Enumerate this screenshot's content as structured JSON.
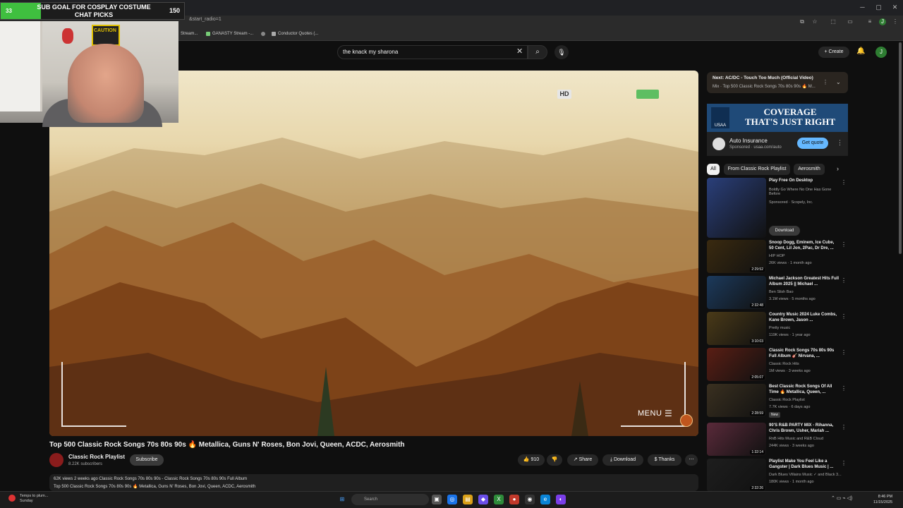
{
  "browser": {
    "url_fragment": "&start_radio=1",
    "bookmarks": [
      "Stream...",
      "GANASTY Stream -...",
      "Conductor Quotes (..."
    ]
  },
  "overlay": {
    "goal_title": "SUB GOAL FOR COSPLAY COSTUME CHAT PICKS",
    "goal_current": "33",
    "goal_max": "150",
    "goal_progress": 0.22,
    "poster_text": "CAUTION"
  },
  "header": {
    "search_query": "the knack my sharona",
    "create_label": "Create",
    "avatar_letter": "J"
  },
  "player": {
    "hd_label": "HD",
    "menu_label": "MENU"
  },
  "video": {
    "title": "Top 500 Classic Rock Songs 70s 80s 90s 🔥 Metallica, Guns N' Roses, Bon Jovi, Queen, ACDC, Aerosmith",
    "channel_name": "Classic Rock Playlist",
    "channel_subs": "8.22K subscribers",
    "subscribe_label": "Subscribe",
    "like_count": "910",
    "share_label": "Share",
    "download_label": "Download",
    "thanks_label": "Thanks",
    "desc_line1": "62K views  2 weeks ago  Classic Rock Songs 70s 80s 90s - Classic Rock Songs 70s 80s 90s Full Album",
    "desc_line2": "Top 500 Classic Rock Songs 70s 80s 90s 🔥 Metallica, Guns N' Roses, Bon Jovi, Queen, ACDC, Aerosmith"
  },
  "up_next": {
    "title": "Next: AC/DC - Touch Too Much (Official Video)",
    "subtitle": "Mix · Top 500 Classic Rock Songs 70s 80s 90s 🔥 M..."
  },
  "ad": {
    "logo": "USAA",
    "headline1": "COVERAGE",
    "headline2": "THAT'S JUST RIGHT",
    "title": "Auto Insurance",
    "sponsor": "Sponsored · usaa.com/auto",
    "cta": "Get quote"
  },
  "chips": [
    "All",
    "From Classic Rock Playlist",
    "Aerosmith"
  ],
  "recommendations": [
    {
      "title": "Play Free On Desktop",
      "channel": "Boldly Go Where No One Has Gone Before",
      "meta": "Sponsored · Scopely, Inc.",
      "duration": "",
      "button": "Download",
      "thumb_color": "#2a3f7a"
    },
    {
      "title": "Snoop Dogg, Eminem, Ice Cube, 50 Cent, Lil Jon, 2Pac, Dr Dre, ...",
      "channel": "HIP HOP",
      "meta": "26K views · 1 month ago",
      "duration": "2:29:52",
      "thumb_color": "#3a2a10"
    },
    {
      "title": "Michael Jackson Greatest Hits Full Album 2025 || Michael ...",
      "channel": "Ben Slish Bao",
      "meta": "3.1M views · 5 months ago",
      "duration": "2:32:48",
      "thumb_color": "#1c3a5c"
    },
    {
      "title": "Country Music 2024 Luke Combs, Kane Brown, Jason ...",
      "channel": "Pretty music",
      "meta": "119K views · 1 year ago",
      "duration": "3:10:03",
      "thumb_color": "#4a3a18"
    },
    {
      "title": "Classic Rock Songs 70s 80s 90s Full Album 🎸 Nirvana, ...",
      "channel": "Classic Rock Hits",
      "meta": "1M views · 3 weeks ago",
      "duration": "2:05:07",
      "thumb_color": "#5a1e14"
    },
    {
      "title": "Best Classic Rock Songs Of All Time 🔥 Metallica, Queen, ...",
      "channel": "Classic Rock Playlist",
      "meta": "7.7K views · 6 days ago",
      "duration": "2:28:59",
      "badge": "New",
      "thumb_color": "#3a3020"
    },
    {
      "title": "90'S R&B PARTY MIX - Rihanna, Chris Brown, Usher, Mariah ...",
      "channel": "RnB Hits Music and R&B Cloud",
      "meta": "244K views · 3 weeks ago",
      "duration": "1:32:14",
      "thumb_color": "#5a2a3a"
    },
    {
      "title": "Playlist Make You Feel Like a Gangster | Dark Blues Music | ...",
      "channel": "Dark Blues Villains Music ✓ and Black 3...",
      "meta": "180K views · 1 month ago",
      "duration": "2:32:26",
      "thumb_color": "#1e1e1e"
    }
  ],
  "taskbar": {
    "weather_line1": "Temps to plum...",
    "weather_line2": "Sunday",
    "search_placeholder": "Search",
    "time": "8:46 PM",
    "date": "11/15/2025"
  }
}
